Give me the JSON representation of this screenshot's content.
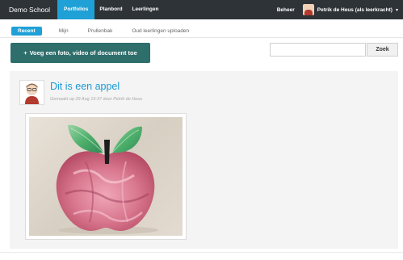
{
  "navbar": {
    "brand": "Demo School",
    "items": [
      {
        "label": "Portfolios",
        "active": true
      },
      {
        "label": "Planbord",
        "active": false
      },
      {
        "label": "Leerlingen",
        "active": false
      }
    ],
    "admin": "Beheer",
    "user": "Petrik de Heus (als leerkracht)",
    "caret": "▾"
  },
  "tabs": [
    {
      "label": "Recent",
      "active": true
    },
    {
      "label": "Mijn",
      "active": false
    },
    {
      "label": "Prullenbak",
      "active": false
    },
    {
      "label": "Oud leerlingen uploaden",
      "active": false
    }
  ],
  "actions": {
    "add_plus": "+",
    "add_label": "Voeg een foto, video of document toe",
    "search_placeholder": "",
    "search_button": "Zoek"
  },
  "post": {
    "title": "Dit is een appel",
    "meta": "Gemaakt op 29 Aug 19:37 door Petrik de Heus"
  },
  "colors": {
    "navbar": "#2e3338",
    "accent": "#1fa0d6",
    "button": "#2e6e6b"
  }
}
